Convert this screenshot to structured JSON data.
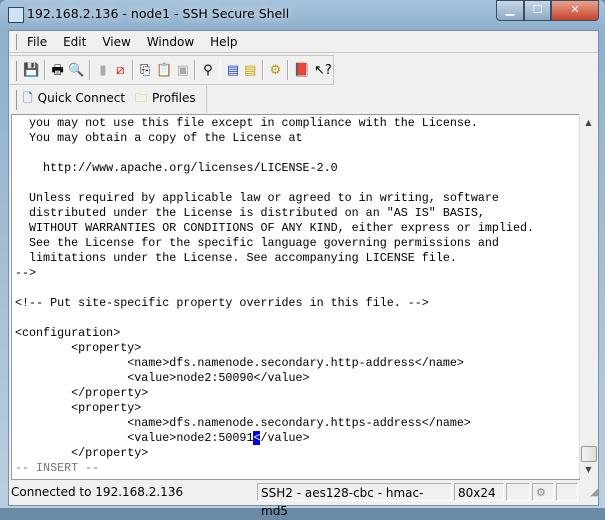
{
  "window": {
    "title": "192.168.2.136 - node1 - SSH Secure Shell"
  },
  "menu": [
    "File",
    "Edit",
    "View",
    "Window",
    "Help"
  ],
  "toolbar_icons": [
    "save-icon",
    "print-icon",
    "print-preview-icon",
    "disconnect-icon",
    "disconnect-red-icon",
    "copy-icon",
    "paste-icon",
    "paste-disabled-icon",
    "find-icon",
    "new-terminal-icon",
    "new-file-transfer-icon",
    "settings-icon",
    "help-book-icon",
    "context-help-icon"
  ],
  "quickbar": {
    "quick_connect": "Quick Connect",
    "profiles": "Profiles"
  },
  "terminal": {
    "lines": [
      "  you may not use this file except in compliance with the License.",
      "  You may obtain a copy of the License at",
      "",
      "    http://www.apache.org/licenses/LICENSE-2.0",
      "",
      "  Unless required by applicable law or agreed to in writing, software",
      "  distributed under the License is distributed on an \"AS IS\" BASIS,",
      "  WITHOUT WARRANTIES OR CONDITIONS OF ANY KIND, either express or implied.",
      "  See the License for the specific language governing permissions and",
      "  limitations under the License. See accompanying LICENSE file.",
      "-->",
      "",
      "<!-- Put site-specific property overrides in this file. -->",
      "",
      "<configuration>",
      "        <property>",
      "                <name>dfs.namenode.secondary.http-address</name>",
      "                <value>node2:50090</value>",
      "        </property>",
      "        <property>",
      "                <name>dfs.namenode.secondary.https-address</name>"
    ],
    "cursor_line_before": "                <value>node2:50091",
    "cursor_char": "<",
    "cursor_line_after": "/value>",
    "after_cursor": [
      "        </property>"
    ],
    "mode_line": "-- INSERT --"
  },
  "status": {
    "connection": "Connected to 192.168.2.136",
    "cipher": "SSH2 - aes128-cbc - hmac-md5",
    "size": "80x24"
  }
}
